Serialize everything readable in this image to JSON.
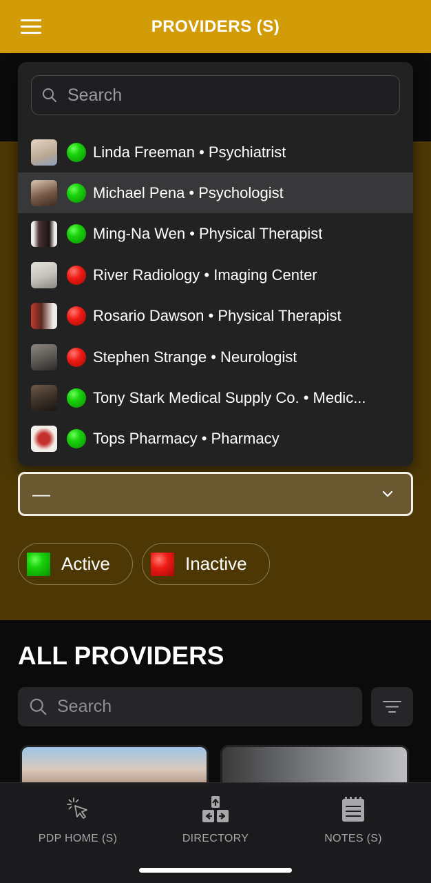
{
  "header": {
    "title": "PROVIDERS (S)",
    "menu_icon": "hamburger-menu-icon"
  },
  "dropdown": {
    "search_placeholder": "Search",
    "options": [
      {
        "name": "Linda Freeman",
        "type": "Psychiatrist",
        "label": "Linda Freeman • Psychiatrist",
        "status": "active",
        "selected": false,
        "avatar_color": "#b9a792"
      },
      {
        "name": "Michael Pena",
        "type": "Psychologist",
        "label": "Michael Pena • Psychologist",
        "status": "active",
        "selected": true,
        "avatar_color": "#7a5a46"
      },
      {
        "name": "Ming-Na Wen",
        "type": "Physical Therapist",
        "label": "Ming-Na Wen • Physical Therapist",
        "status": "active",
        "selected": false,
        "avatar_color": "#4a3436"
      },
      {
        "name": "River Radiology",
        "type": "Imaging Center",
        "label": "River Radiology • Imaging Center",
        "status": "inactive",
        "selected": false,
        "avatar_color": "#c8c4bf"
      },
      {
        "name": "Rosario Dawson",
        "type": "Physical Therapist",
        "label": "Rosario Dawson • Physical Therapist",
        "status": "inactive",
        "selected": false,
        "avatar_color": "#9b4a3c"
      },
      {
        "name": "Stephen Strange",
        "type": "Neurologist",
        "label": "Stephen Strange • Neurologist",
        "status": "inactive",
        "selected": false,
        "avatar_color": "#5f5a55"
      },
      {
        "name": "Tony Stark Medical Supply Co.",
        "type": "Medic...",
        "label": "Tony Stark Medical Supply Co. • Medic...",
        "status": "active",
        "selected": false,
        "avatar_color": "#3e3229"
      },
      {
        "name": "Tops Pharmacy",
        "type": "Pharmacy",
        "label": "Tops Pharmacy • Pharmacy",
        "status": "active",
        "selected": false,
        "avatar_color": "#c2302e"
      }
    ]
  },
  "select": {
    "value": "—",
    "chevron_icon": "chevron-down-icon"
  },
  "legend": {
    "active_label": "Active",
    "inactive_label": "Inactive"
  },
  "all_providers": {
    "title": "ALL PROVIDERS",
    "search_placeholder": "Search",
    "filter_icon": "filter-icon"
  },
  "tabbar": {
    "tabs": [
      {
        "label": "PDP HOME (S)",
        "icon": "tap-cursor-icon"
      },
      {
        "label": "DIRECTORY",
        "icon": "directory-arrows-icon"
      },
      {
        "label": "NOTES (S)",
        "icon": "notepad-icon"
      }
    ]
  },
  "colors": {
    "header": "#d29c08",
    "panel": "#4d3805",
    "active": "#19d20b",
    "inactive": "#ee1b14"
  }
}
